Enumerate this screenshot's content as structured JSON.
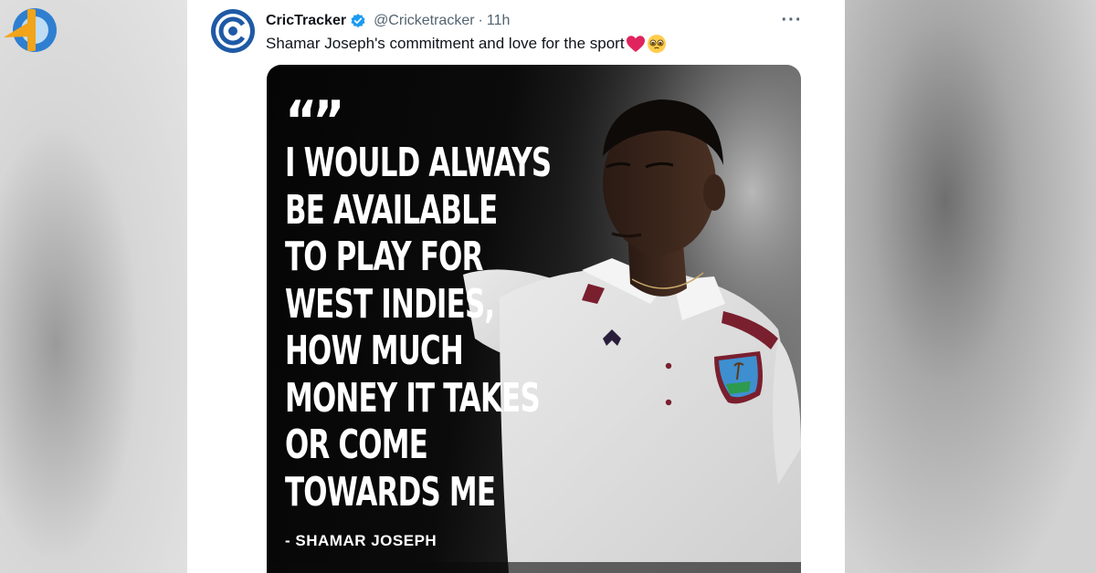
{
  "tweet": {
    "display_name": "CricTracker",
    "handle": "@Cricketracker",
    "separator": "·",
    "time": "11h",
    "text": "Shamar Joseph's commitment and love for the sport",
    "emojis": [
      "red-heart",
      "pleading-face"
    ],
    "more_label": "···"
  },
  "media": {
    "quote_marks": "“”",
    "quote_lines": [
      "I WOULD ALWAYS",
      "BE AVAILABLE",
      "TO PLAY FOR",
      "WEST INDIES,",
      "HOW MUCH",
      "MONEY IT TAKES",
      "OR COME",
      "TOWARDS ME"
    ],
    "attribution": "- SHAMAR JOSEPH"
  },
  "icons": {
    "verified": "verified-badge-icon",
    "more": "more-options-icon",
    "watermark": "site-logo"
  },
  "colors": {
    "verified_blue": "#1d9bf0",
    "avatar_blue": "#1f5aa6",
    "heart_red": "#e0245e",
    "jersey_maroon": "#7a1f2e"
  }
}
